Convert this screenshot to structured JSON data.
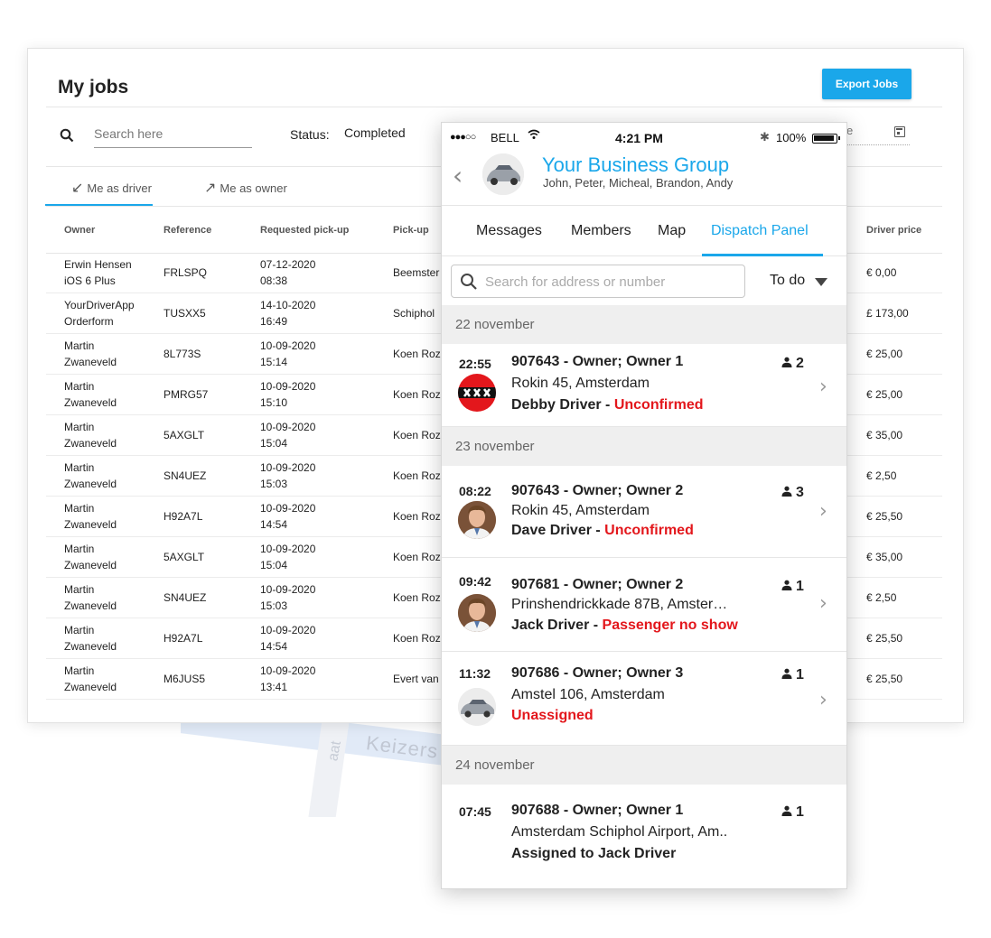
{
  "desktop": {
    "title": "My jobs",
    "export_label": "Export Jobs",
    "search_placeholder": "Search here",
    "status_label": "Status:",
    "status_value": "Completed",
    "date_fragment": "e",
    "tabs": [
      {
        "label": "Me as driver",
        "icon": "arrow-down-left-icon"
      },
      {
        "label": "Me as owner",
        "icon": "arrow-up-right-icon"
      }
    ],
    "columns": {
      "owner": "Owner",
      "reference": "Reference",
      "requested_pickup": "Requested pick-up",
      "pickup": "Pick-up",
      "driver_price": "Driver price"
    },
    "rows": [
      {
        "owner1": "Erwin Hensen",
        "owner2": "iOS 6 Plus",
        "ref": "FRLSPQ",
        "date": "07-12-2020",
        "time": "08:38",
        "pickup": "Beemster",
        "price": "€ 0,00"
      },
      {
        "owner1": "YourDriverApp",
        "owner2": "Orderform",
        "ref": "TUSXX5",
        "date": "14-10-2020",
        "time": "16:49",
        "pickup": "Schiphol",
        "price": "£ 173,00"
      },
      {
        "owner1": "Martin",
        "owner2": "Zwaneveld",
        "ref": "8L773S",
        "date": "10-09-2020",
        "time": "15:14",
        "pickup": "Koen Roz",
        "price": "€ 25,00"
      },
      {
        "owner1": "Martin",
        "owner2": "Zwaneveld",
        "ref": "PMRG57",
        "date": "10-09-2020",
        "time": "15:10",
        "pickup": "Koen Roz",
        "price": "€ 25,00"
      },
      {
        "owner1": "Martin",
        "owner2": "Zwaneveld",
        "ref": "5AXGLT",
        "date": "10-09-2020",
        "time": "15:04",
        "pickup": "Koen Roz",
        "price": "€ 35,00"
      },
      {
        "owner1": "Martin",
        "owner2": "Zwaneveld",
        "ref": "SN4UEZ",
        "date": "10-09-2020",
        "time": "15:03",
        "pickup": "Koen Roz",
        "price": "€ 2,50"
      },
      {
        "owner1": "Martin",
        "owner2": "Zwaneveld",
        "ref": "H92A7L",
        "date": "10-09-2020",
        "time": "14:54",
        "pickup": "Koen Roz",
        "price": "€ 25,50"
      },
      {
        "owner1": "Martin",
        "owner2": "Zwaneveld",
        "ref": "5AXGLT",
        "date": "10-09-2020",
        "time": "15:04",
        "pickup": "Koen Roz",
        "price": "€ 35,00"
      },
      {
        "owner1": "Martin",
        "owner2": "Zwaneveld",
        "ref": "SN4UEZ",
        "date": "10-09-2020",
        "time": "15:03",
        "pickup": "Koen Roz",
        "price": "€ 2,50"
      },
      {
        "owner1": "Martin",
        "owner2": "Zwaneveld",
        "ref": "H92A7L",
        "date": "10-09-2020",
        "time": "14:54",
        "pickup": "Koen Roz",
        "price": "€ 25,50"
      },
      {
        "owner1": "Martin",
        "owner2": "Zwaneveld",
        "ref": "M6JUS5",
        "date": "10-09-2020",
        "time": "13:41",
        "pickup": "Evert van",
        "price": "€ 25,50"
      }
    ]
  },
  "map": {
    "street": "Keizers",
    "street2": "aat"
  },
  "phone": {
    "status": {
      "signal": "●●●○○",
      "carrier": "BELL",
      "time": "4:21 PM",
      "battery": "100%"
    },
    "group": {
      "title": "Your Business Group",
      "members": "John, Peter, Micheal, Brandon, Andy"
    },
    "tabs": [
      "Messages",
      "Members",
      "Map",
      "Dispatch Panel"
    ],
    "search_placeholder": "Search for address or number",
    "filter": "To do",
    "sections": [
      {
        "label": "22 november"
      },
      {
        "label": "23 november"
      },
      {
        "label": "24 november"
      }
    ],
    "items": [
      {
        "time": "22:55",
        "title": "907643 - Owner; Owner 1",
        "address": "Rokin 45, Amsterdam",
        "driver": "Debby Driver - ",
        "status": "Unconfirmed",
        "pax": "2",
        "avatar": "amsterdam-logo"
      },
      {
        "time": "08:22",
        "title": "907643 - Owner; Owner 2",
        "address": "Rokin 45, Amsterdam",
        "driver": "Dave Driver - ",
        "status": "Unconfirmed",
        "pax": "3",
        "avatar": "driver-photo"
      },
      {
        "time": "09:42",
        "title": "907681 - Owner; Owner 2",
        "address": "Prinshendrickkade 87B, Amster…",
        "driver": "Jack Driver - ",
        "status": "Passenger no show",
        "pax": "1",
        "avatar": "driver-photo"
      },
      {
        "time": "11:32",
        "title": "907686 - Owner; Owner 3",
        "address": "Amstel 106, Amsterdam",
        "driver": "",
        "status": "Unassigned",
        "pax": "1",
        "avatar": "car-photo"
      },
      {
        "time": "07:45",
        "title": "907688 - Owner; Owner 1",
        "address": "Amsterdam Schiphol Airport, Am..",
        "driver": "Assigned to Jack Driver",
        "status": "",
        "pax": "1",
        "avatar": ""
      }
    ]
  },
  "colors": {
    "accent": "#1aa7ea",
    "status_red": "#e3171c"
  }
}
